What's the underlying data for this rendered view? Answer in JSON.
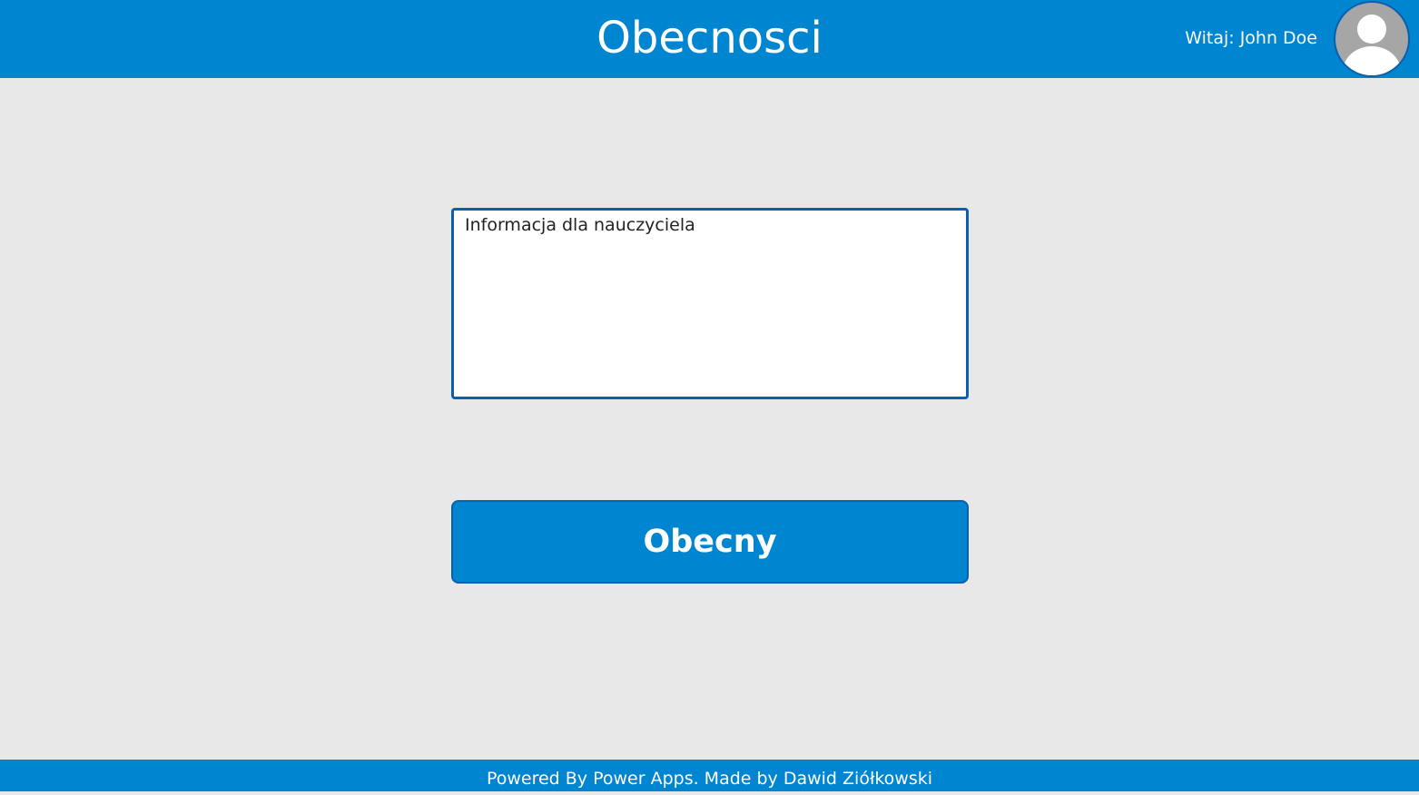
{
  "header": {
    "title": "Obecnosci",
    "greeting": "Witaj: John Doe",
    "avatar_icon": "user-avatar-icon"
  },
  "form": {
    "message_placeholder": "Informacja dla nauczyciela",
    "message_value": "",
    "submit_label": "Obecny"
  },
  "footer": {
    "text": "Powered By Power Apps. Made by Dawid Ziółkowski"
  },
  "colors": {
    "brand": "#0085d1",
    "border_accent": "#0a5fae",
    "background": "#e8e8e8",
    "avatar_bg": "#a6a6a6"
  }
}
